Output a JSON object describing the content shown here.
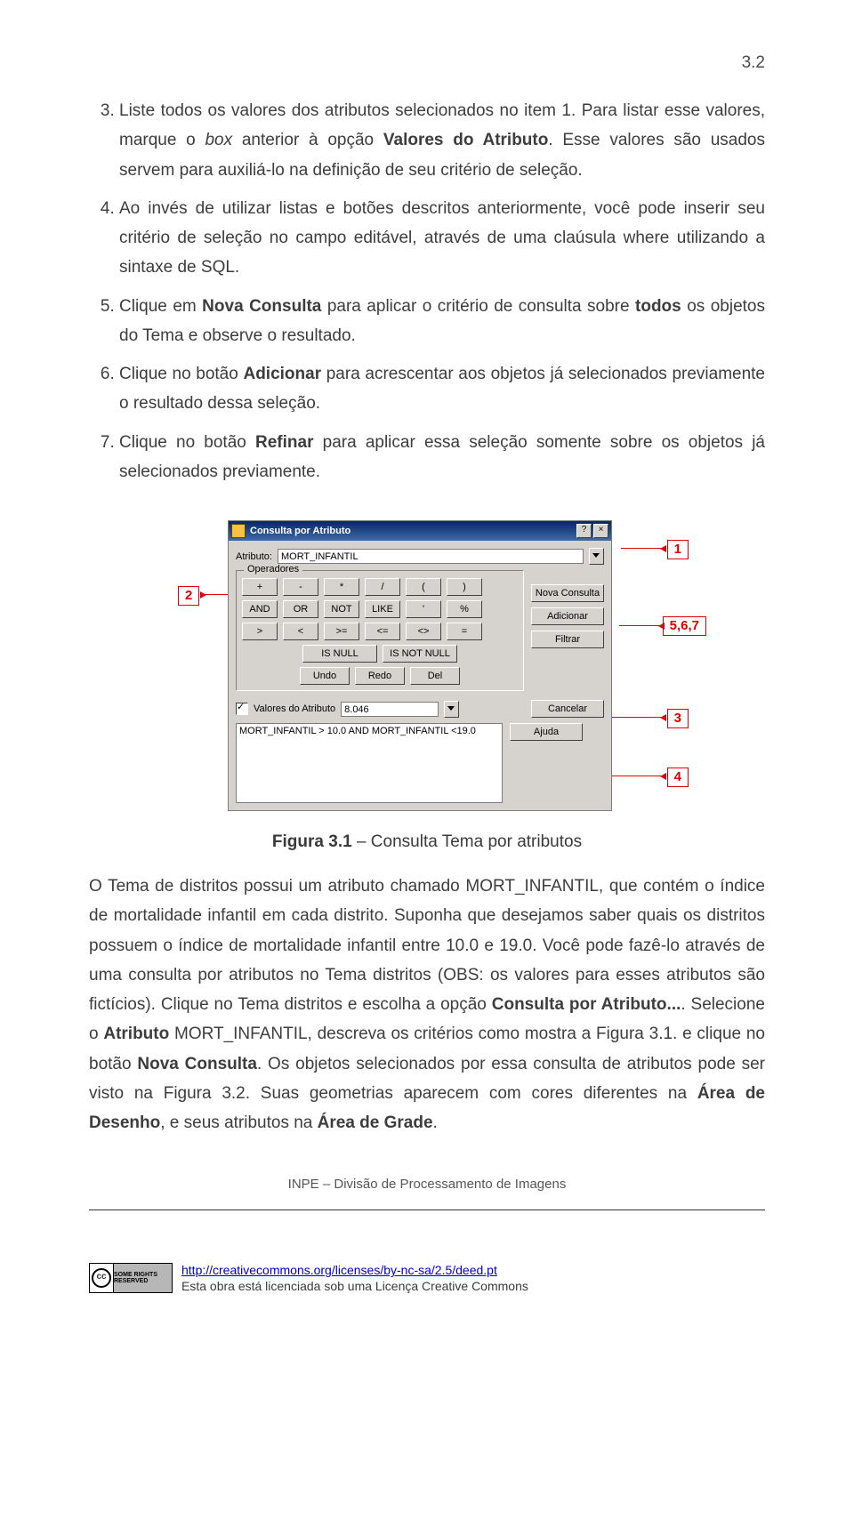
{
  "page_number": "3.2",
  "list": {
    "start": 3,
    "items": [
      {
        "pre": "Liste todos os valores dos atributos selecionados no item 1. Para listar esse valores, marque o ",
        "it": "box",
        "mid": " anterior à opção ",
        "b1": "Valores do Atributo",
        "post": ". Esse valores são usados servem para auxiliá-lo na definição de seu critério de seleção."
      },
      {
        "full": "Ao invés de utilizar listas e botões descritos anteriormente, você pode inserir seu critério de seleção no campo editável, através de uma claúsula where utilizando a sintaxe de SQL."
      },
      {
        "pre": "Clique em ",
        "b1": "Nova Consulta",
        "mid": " para aplicar o critério de consulta sobre ",
        "b2": "todos",
        "post": " os objetos do Tema e observe o resultado."
      },
      {
        "pre": "Clique no botão ",
        "b1": "Adicionar",
        "post": " para acrescentar aos objetos já selecionados previamente o resultado dessa seleção."
      },
      {
        "pre": "Clique no botão ",
        "b1": "Refinar",
        "post": " para aplicar essa seleção somente sobre os objetos já selecionados previamente."
      }
    ]
  },
  "dialog": {
    "title": "Consulta por Atributo",
    "help_btn": "?",
    "close_btn": "×",
    "attr_label": "Atributo:",
    "attr_value": "MORT_INFANTIL",
    "operators_label": "Operadores",
    "ops_r1": [
      "+",
      "-",
      "*",
      "/",
      "(",
      ")"
    ],
    "ops_r2": [
      "AND",
      "OR",
      "NOT",
      "LIKE",
      "'",
      "%"
    ],
    "ops_r3": [
      ">",
      "<",
      ">=",
      "<=",
      "<>",
      "="
    ],
    "ops_r4": [
      "IS NULL",
      "IS NOT NULL"
    ],
    "urd": {
      "undo": "Undo",
      "redo": "Redo",
      "del": "Del"
    },
    "side": {
      "nova": "Nova Consulta",
      "adic": "Adicionar",
      "filt": "Filtrar",
      "canc": "Cancelar",
      "ajuda": "Ajuda"
    },
    "chk_label": "Valores do Atributo",
    "chk_value": "8.046",
    "sql": "MORT_INFANTIL > 10.0 AND MORT_INFANTIL <19.0"
  },
  "callouts": {
    "c1": "1",
    "c2": "2",
    "c3": "3",
    "c4": "4",
    "c567": "5,6,7"
  },
  "caption": {
    "b": "Figura 3.1",
    "rest": " – Consulta Tema por atributos"
  },
  "para": {
    "t1": "O Tema de distritos possui um atributo chamado MORT_INFANTIL, que contém o índice de mortalidade infantil em cada distrito. Suponha que desejamos saber quais os distritos possuem o índice de mortalidade infantil entre 10.0 e 19.0. Você pode fazê-lo através de uma consulta por atributos no Tema distritos (OBS: os valores para esses atributos são fictícios).   Clique no Tema distritos e escolha a opção ",
    "b1": "Consulta por Atributo...",
    "t2": ". Selecione o ",
    "b2": "Atributo",
    "t3": " MORT_INFANTIL, descreva os critérios como mostra a Figura 3.1. e clique no botão ",
    "b3": "Nova Consulta",
    "t4": ". Os objetos selecionados por essa consulta de atributos pode ser visto na Figura 3.2. Suas geometrias aparecem com cores diferentes na ",
    "b4": "Área de Desenho",
    "t5": ", e seus atributos na ",
    "b5": "Área de Grade",
    "t6": "."
  },
  "footer": {
    "center": "INPE – Divisão de Processamento de Imagens",
    "cc_text": "SOME RIGHTS RESERVED",
    "link": "http://creativecommons.org/licenses/by-nc-sa/2.5/deed.pt",
    "license": "Esta obra está licenciada sob uma Licença Creative Commons"
  }
}
